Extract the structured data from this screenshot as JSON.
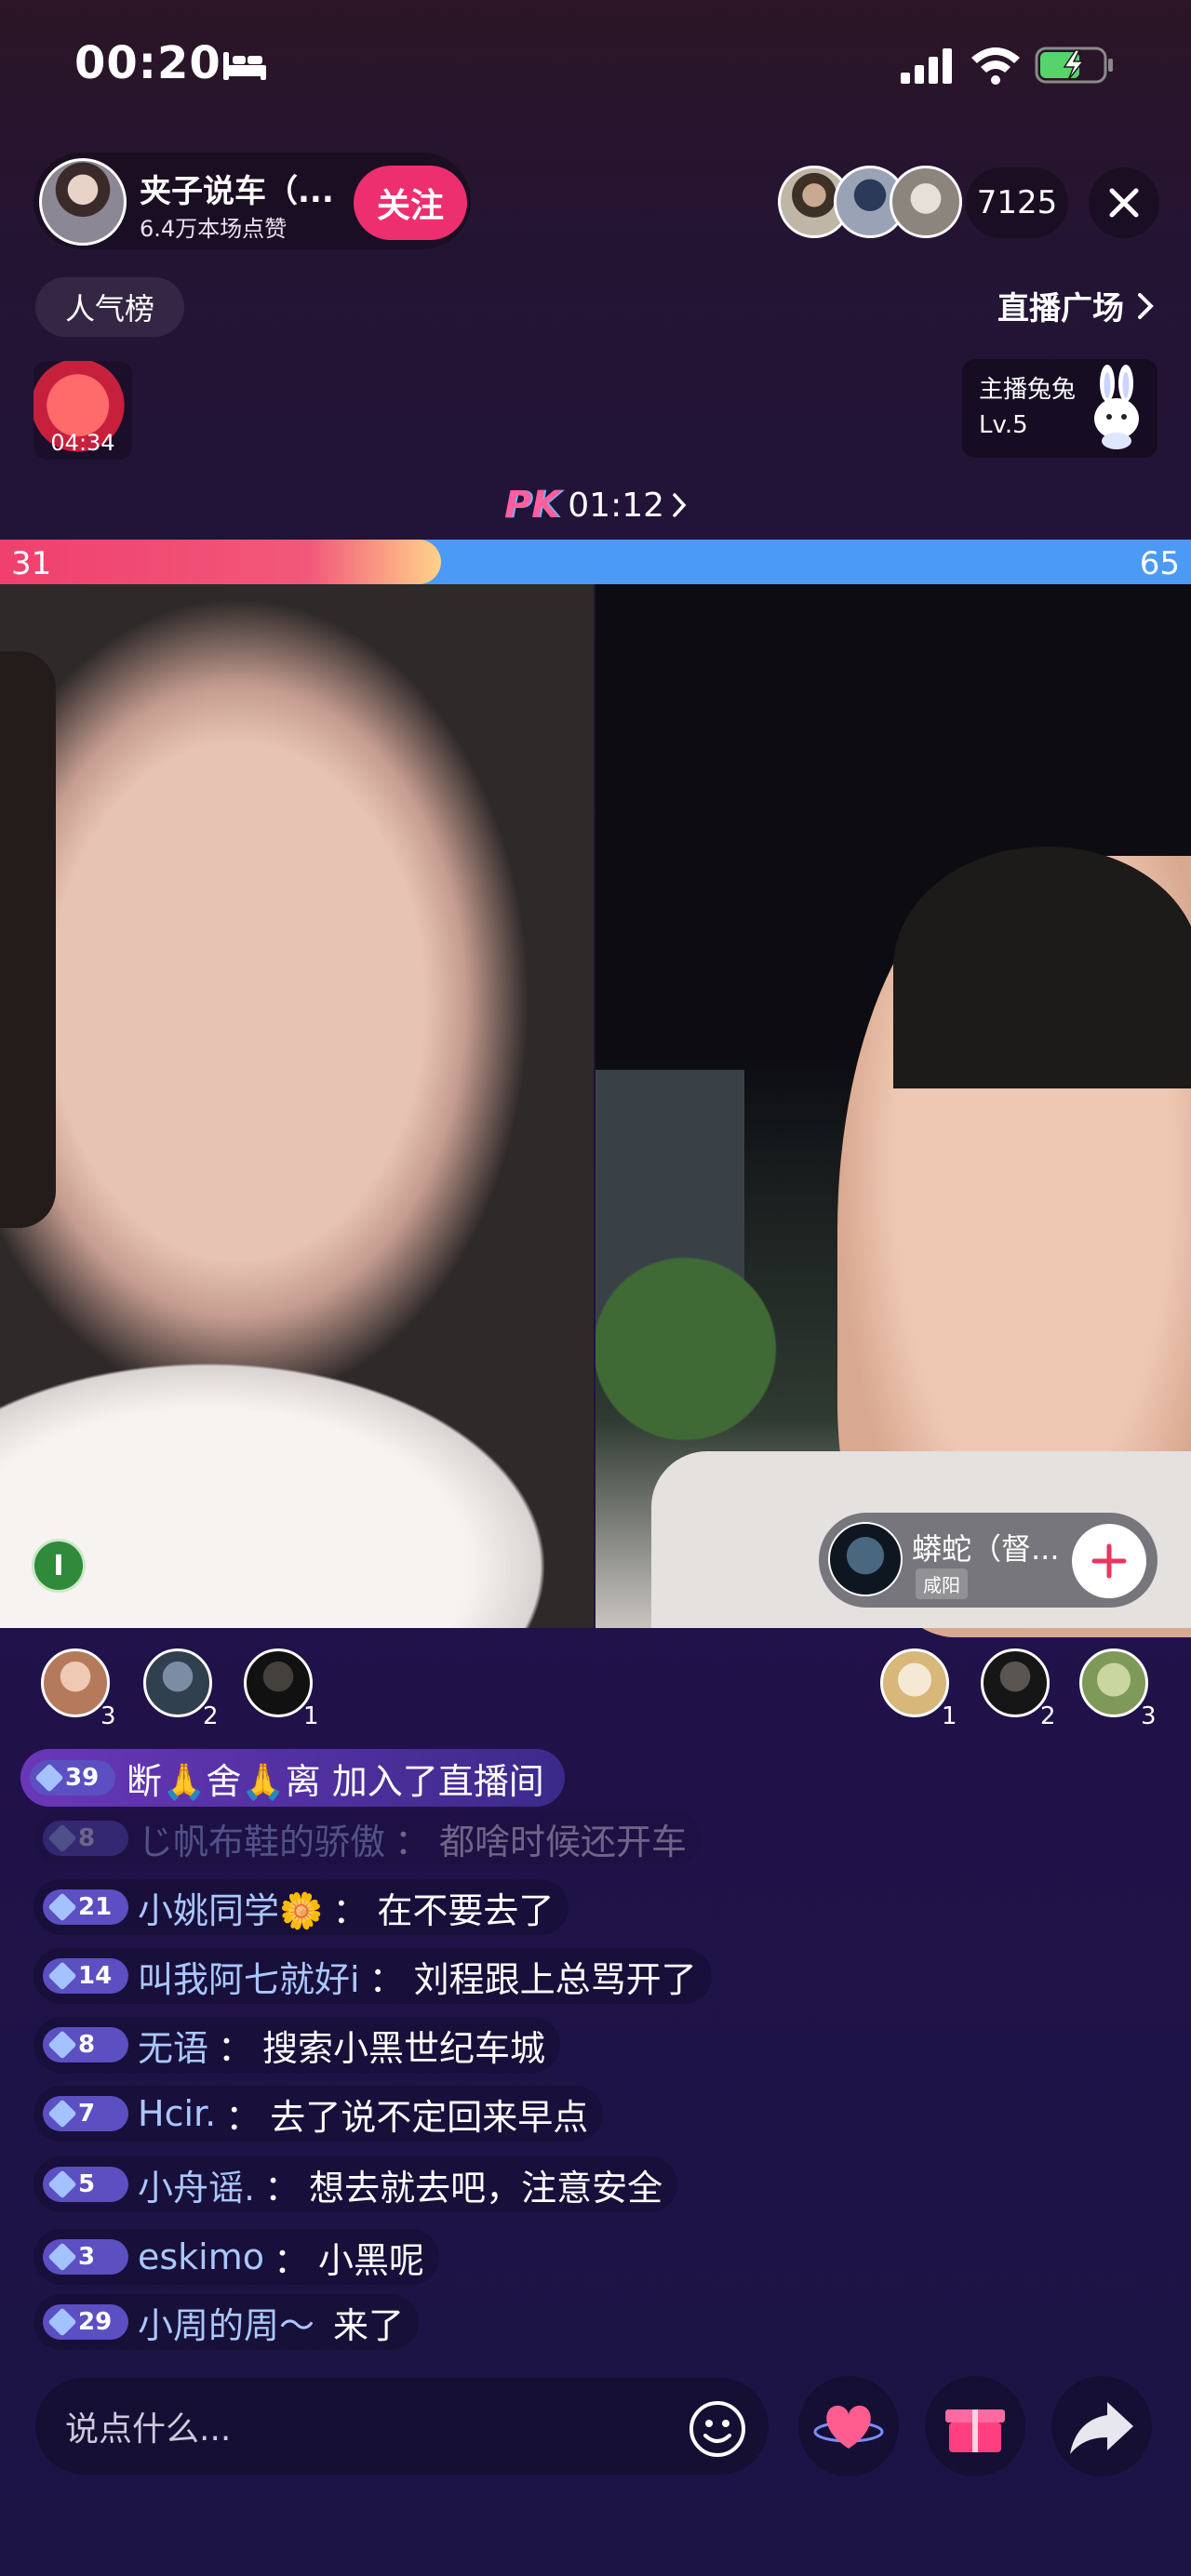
{
  "status_bar": {
    "time": "00:20"
  },
  "header": {
    "host_name": "夹子说车（...",
    "host_likes": "6.4万本场点赞",
    "follow_label": "关注",
    "viewer_count": "7125"
  },
  "nav": {
    "rank_label": "人气榜",
    "plaza_label": "直播广场"
  },
  "gift_box": {
    "timer": "04:34"
  },
  "level_card": {
    "title": "主播兔兔",
    "level": "Lv.5"
  },
  "pk": {
    "logo": "PK",
    "timer": "01:12",
    "score_left": "31",
    "score_right": "65",
    "left_share": 0.37
  },
  "opponent": {
    "name": "蟒蛇（督...",
    "city": "咸阳"
  },
  "contributors": {
    "left_ranks": [
      "3",
      "2",
      "1"
    ],
    "right_ranks": [
      "1",
      "2",
      "3"
    ]
  },
  "join_banner": {
    "level": "39",
    "text": "断🙏舍🙏离 加入了直播间"
  },
  "chat": [
    {
      "level": "8",
      "user": "じ帆布鞋的骄傲",
      "sep": "：",
      "msg": "都啥时候还开车"
    },
    {
      "level": "21",
      "user": "小姚同学🌼",
      "sep": "：",
      "msg": "在不要去了"
    },
    {
      "level": "14",
      "user": "叫我阿七就好i",
      "sep": "：",
      "msg": "刘程跟上总骂开了"
    },
    {
      "level": "8",
      "user": "无语",
      "sep": "：",
      "msg": "搜索小黑世纪车城"
    },
    {
      "level": "7",
      "user": "Hcir.",
      "sep": "：",
      "msg": "去了说不定回来早点"
    },
    {
      "level": "5",
      "user": "小舟谣.",
      "sep": "：",
      "msg": "想去就去吧，注意安全"
    },
    {
      "level": "3",
      "user": "eskimo",
      "sep": "：",
      "msg": "小黑呢"
    },
    {
      "level": "29",
      "user": "小周的周～",
      "sep": "",
      "msg": "来了"
    }
  ],
  "input": {
    "placeholder": "说点什么..."
  },
  "colors": {
    "pk_left": "#f0406d",
    "pk_right": "#4b9af6",
    "follow": "#ee2f6f",
    "chat_user": "#a9c8ff"
  }
}
